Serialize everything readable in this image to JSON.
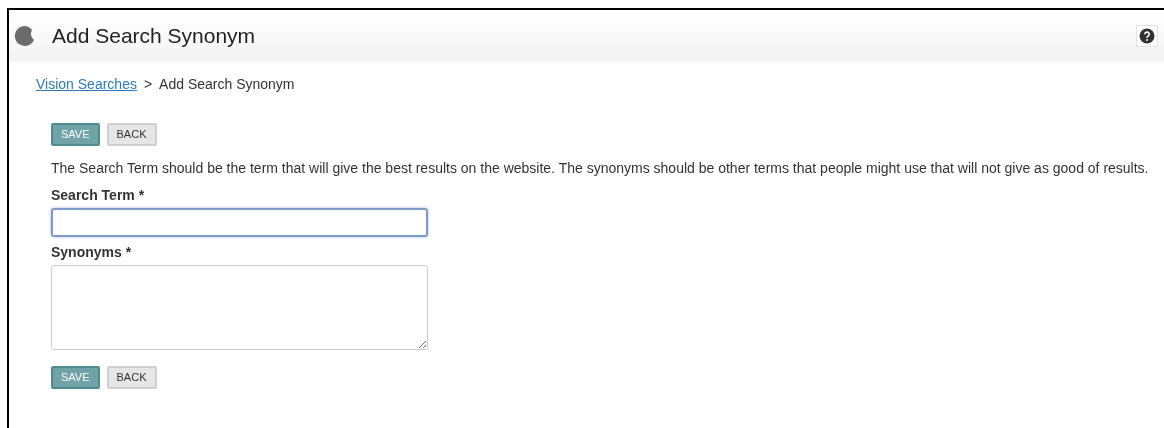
{
  "header": {
    "title": "Add Search Synonym"
  },
  "breadcrumb": [
    {
      "label": "Vision Searches",
      "kind": "link"
    },
    {
      "label": ">",
      "kind": "separator"
    },
    {
      "label": "Add Search Synonym",
      "kind": "current"
    }
  ],
  "top_buttons": [
    {
      "label": "SAVE",
      "kind": "primary"
    },
    {
      "label": "BACK",
      "kind": "secondary"
    }
  ],
  "description": "The Search Term should be the term that will give the best results on the website. The synonyms should be other terms that people might use that will not give as good of results.",
  "fields": [
    {
      "label": "Search Term *",
      "kind": "input",
      "focused": true
    },
    {
      "label": "Synonyms *",
      "kind": "textarea",
      "focused": false
    }
  ],
  "bottom_buttons": [
    {
      "label": "SAVE",
      "kind": "primary"
    },
    {
      "label": "BACK",
      "kind": "secondary"
    }
  ]
}
